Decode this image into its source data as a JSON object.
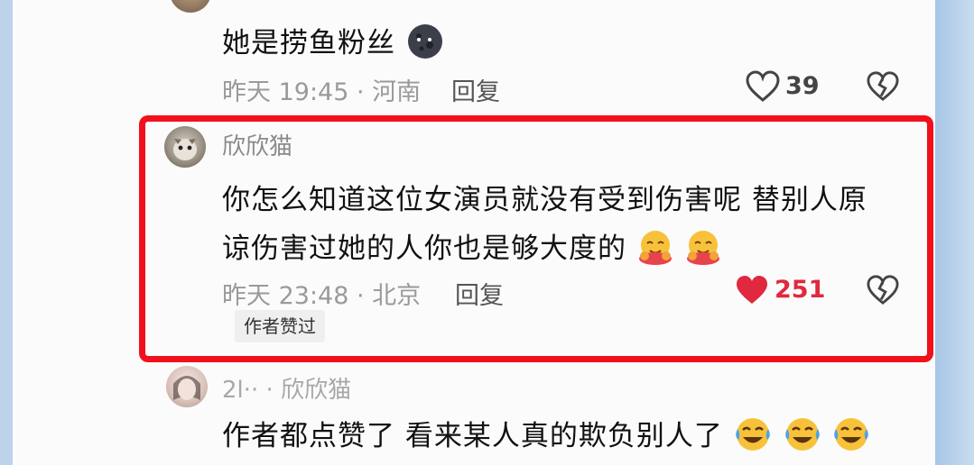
{
  "comments": [
    {
      "text": "她是捞鱼粉丝",
      "time_location": "昨天 19:45 · 河南",
      "reply_label": "回复",
      "likes": "39",
      "liked": false
    },
    {
      "username": "欣欣猫",
      "text_line1": "你怎么知道这位女演员就没有受到伤害呢 替别人原",
      "text_line2": "谅伤害过她的人你也是够大度的",
      "time_location": "昨天 23:48 · 北京",
      "reply_label": "回复",
      "likes": "251",
      "liked": true,
      "author_badge": "作者赞过"
    },
    {
      "username": "2l·· · 欣欣猫",
      "text": "作者都点赞了 看来某人真的欺负别人了"
    }
  ],
  "colors": {
    "highlight_border": "#f2101c",
    "like_active": "#e0283e"
  },
  "icons": [
    "heart-icon",
    "broken-heart-icon",
    "hug-emoji-icon",
    "crying-laughing-emoji-icon",
    "dark-moon-emoji-icon"
  ]
}
